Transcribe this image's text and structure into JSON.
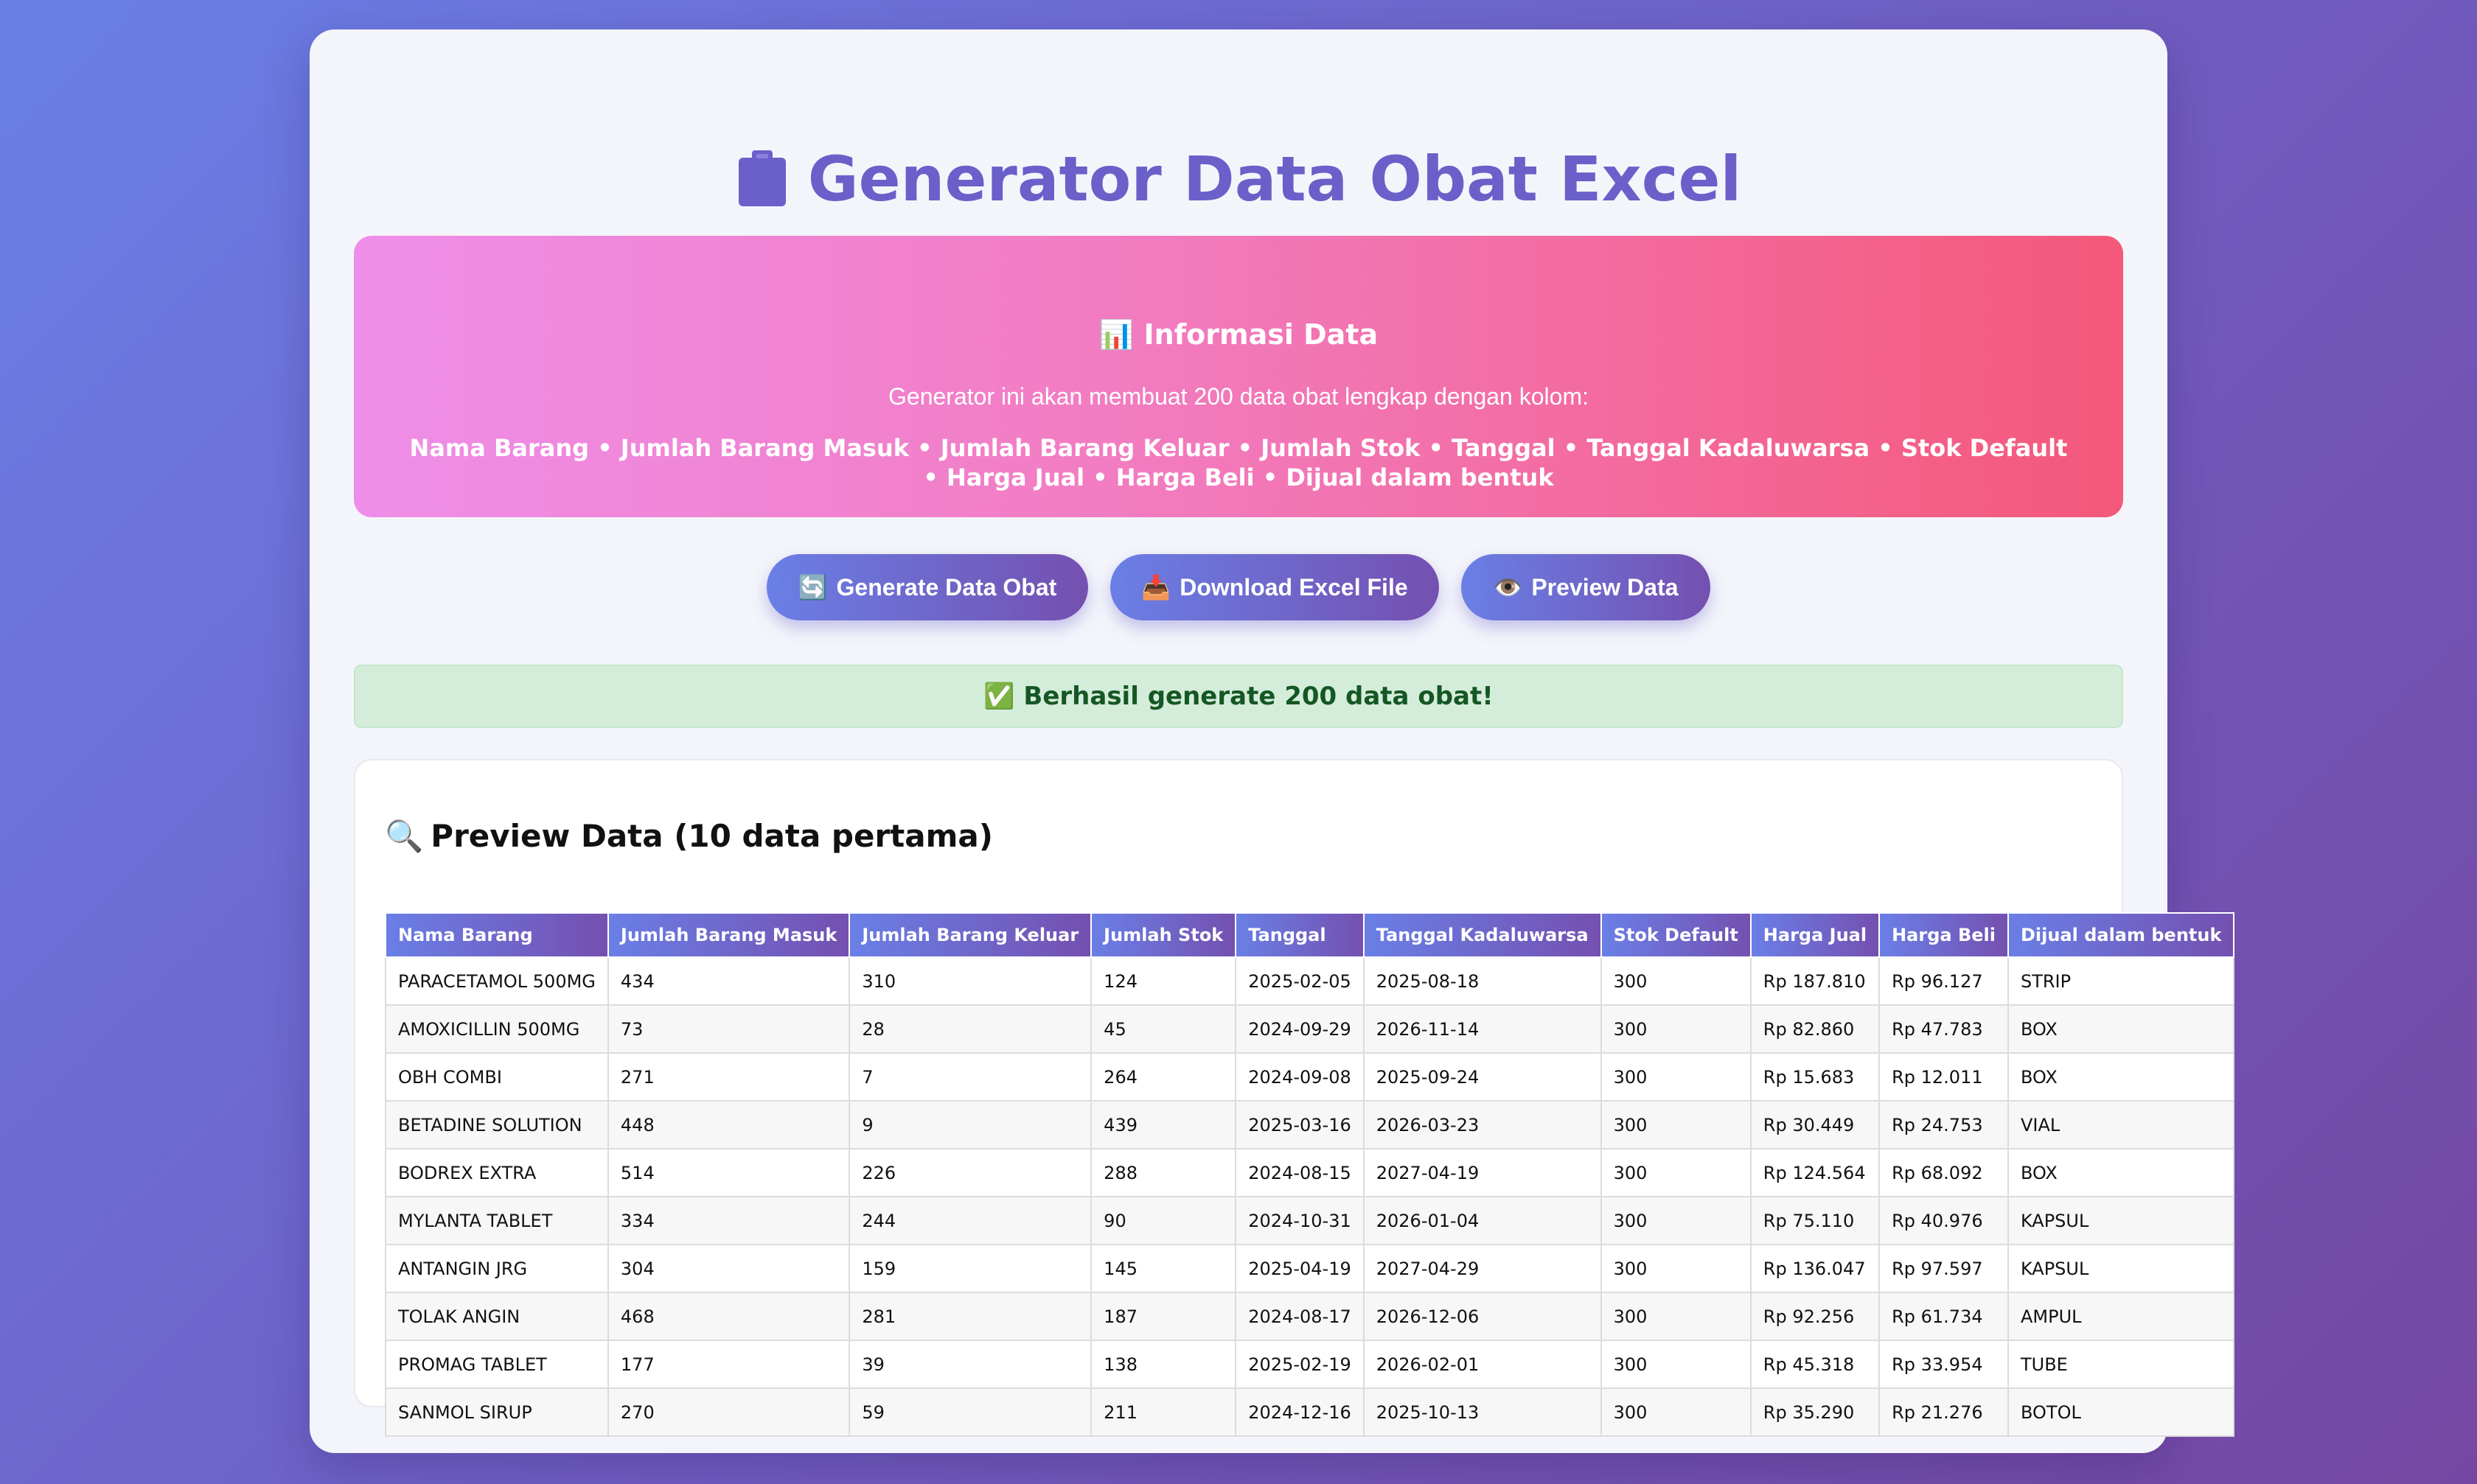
{
  "header": {
    "title": "Generator Data Obat Excel",
    "icon": "clipboard-icon"
  },
  "info": {
    "icon": "📊",
    "title": "Informasi Data",
    "description": "Generator ini akan membuat 200 data obat lengkap dengan kolom:",
    "columns_text": "Nama Barang • Jumlah Barang Masuk • Jumlah Barang Keluar • Jumlah Stok • Tanggal • Tanggal Kadaluwarsa • Stok Default • Harga Jual • Harga Beli • Dijual dalam bentuk",
    "gradient": [
      "#ef8ee9",
      "#f4587a"
    ]
  },
  "buttons": {
    "generate": {
      "icon": "🔄",
      "label": "Generate Data Obat"
    },
    "download": {
      "icon": "📥",
      "label": "Download Excel File"
    },
    "preview": {
      "icon": "👁️",
      "label": "Preview Data"
    }
  },
  "status": {
    "icon": "✅",
    "message": "Berhasil generate 200 data obat!"
  },
  "preview": {
    "icon": "🔍",
    "title": "Preview Data (10 data pertama)",
    "columns": [
      "Nama Barang",
      "Jumlah Barang Masuk",
      "Jumlah Barang Keluar",
      "Jumlah Stok",
      "Tanggal",
      "Tanggal Kadaluwarsa",
      "Stok Default",
      "Harga Jual",
      "Harga Beli",
      "Dijual dalam bentuk"
    ],
    "rows": [
      [
        "PARACETAMOL 500MG",
        "434",
        "310",
        "124",
        "2025-02-05",
        "2025-08-18",
        "300",
        "Rp 187.810",
        "Rp 96.127",
        "STRIP"
      ],
      [
        "AMOXICILLIN 500MG",
        "73",
        "28",
        "45",
        "2024-09-29",
        "2026-11-14",
        "300",
        "Rp 82.860",
        "Rp 47.783",
        "BOX"
      ],
      [
        "OBH COMBI",
        "271",
        "7",
        "264",
        "2024-09-08",
        "2025-09-24",
        "300",
        "Rp 15.683",
        "Rp 12.011",
        "BOX"
      ],
      [
        "BETADINE SOLUTION",
        "448",
        "9",
        "439",
        "2025-03-16",
        "2026-03-23",
        "300",
        "Rp 30.449",
        "Rp 24.753",
        "VIAL"
      ],
      [
        "BODREX EXTRA",
        "514",
        "226",
        "288",
        "2024-08-15",
        "2027-04-19",
        "300",
        "Rp 124.564",
        "Rp 68.092",
        "BOX"
      ],
      [
        "MYLANTA TABLET",
        "334",
        "244",
        "90",
        "2024-10-31",
        "2026-01-04",
        "300",
        "Rp 75.110",
        "Rp 40.976",
        "KAPSUL"
      ],
      [
        "ANTANGIN JRG",
        "304",
        "159",
        "145",
        "2025-04-19",
        "2027-04-29",
        "300",
        "Rp 136.047",
        "Rp 97.597",
        "KAPSUL"
      ],
      [
        "TOLAK ANGIN",
        "468",
        "281",
        "187",
        "2024-08-17",
        "2026-12-06",
        "300",
        "Rp 92.256",
        "Rp 61.734",
        "AMPUL"
      ],
      [
        "PROMAG TABLET",
        "177",
        "39",
        "138",
        "2025-02-19",
        "2026-02-01",
        "300",
        "Rp 45.318",
        "Rp 33.954",
        "TUBE"
      ],
      [
        "SANMOL SIRUP",
        "270",
        "59",
        "211",
        "2024-12-16",
        "2025-10-13",
        "300",
        "Rp 35.290",
        "Rp 21.276",
        "BOTOL"
      ]
    ]
  },
  "colors": {
    "accent": "#6b5fc9",
    "success_bg": "#d4edda",
    "success_text": "#155724"
  }
}
